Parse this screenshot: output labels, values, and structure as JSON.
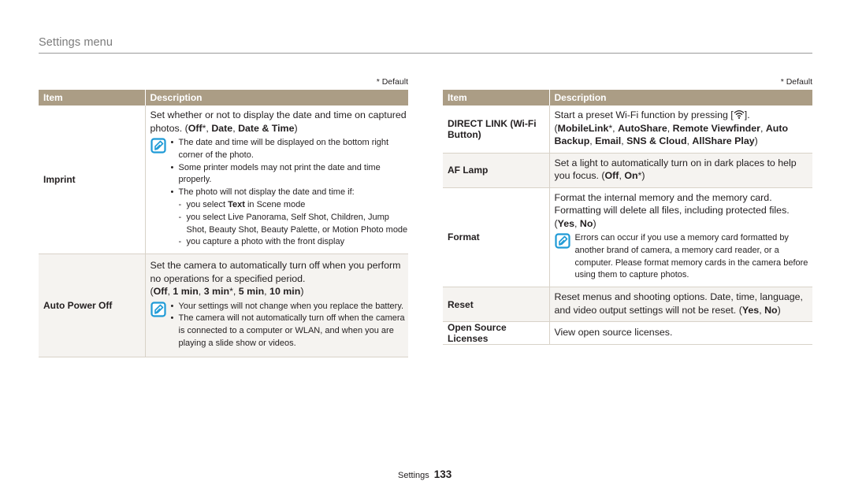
{
  "section_title": "Settings menu",
  "default_note": "* Default",
  "headers": {
    "item": "Item",
    "description": "Description"
  },
  "colors": {
    "header_bg": "#ab9d85",
    "shade_bg": "#f5f3f0",
    "note_icon": "#1e9ad6"
  },
  "left_table": {
    "imprint": {
      "item": "Imprint",
      "lead_1": "Set whether or not to display the date and time on captured photos. (",
      "opt_off": "Off",
      "star_1": "*, ",
      "opt_date": "Date",
      "sep_1": ", ",
      "opt_datetime": "Date & Time",
      "close": ")",
      "note_icon": "note-pencil-icon",
      "bullets": [
        "The date and time will be displayed on the bottom right corner of the photo.",
        "Some printer models may not print the date and time properly.",
        "The photo will not display the date and time if:"
      ],
      "dash_1_pre": "you select ",
      "dash_1_bold": "Text",
      "dash_1_post": " in Scene mode",
      "dash_2": "you select Live Panorama, Self Shot, Children, Jump Shot, Beauty Shot, Beauty Palette, or Motion Photo mode",
      "dash_3": "you capture a photo with the front display"
    },
    "auto_power_off": {
      "item": "Auto Power Off",
      "lead": "Set the camera to automatically turn off when you perform no operations for a specified period.",
      "open": "(",
      "opt_off": "Off",
      "sep_1": ", ",
      "opt_1min": "1 min",
      "sep_2": ", ",
      "opt_3min": "3 min",
      "star": "*, ",
      "opt_5min": "5 min",
      "sep_3": ", ",
      "opt_10min": "10 min",
      "close": ")",
      "note_icon": "note-pencil-icon",
      "bullets": [
        "Your settings will not change when you replace the battery.",
        "The camera will not automatically turn off when the camera is connected to a computer or WLAN, and when you are playing a slide show or videos."
      ]
    }
  },
  "right_table": {
    "direct_link": {
      "item": "DIRECT LINK (Wi-Fi Button)",
      "lead_pre": "Start a preset Wi-Fi function by pressing [",
      "lead_icon": "wifi-icon",
      "lead_post": "].",
      "open": "(",
      "opt_mobilelink": "MobileLink",
      "star": "*, ",
      "opt_autoshare": "AutoShare",
      "sep_1": ", ",
      "opt_remote": "Remote Viewfinder",
      "sep_2": ", ",
      "opt_backup": "Auto Backup",
      "sep_3": ", ",
      "opt_email": "Email",
      "sep_4": ", ",
      "opt_sns": "SNS & Cloud",
      "sep_5": ", ",
      "opt_allshare": "AllShare Play",
      "close": ")"
    },
    "af_lamp": {
      "item": "AF Lamp",
      "lead": "Set a light to automatically turn on in dark places to help you focus. (",
      "opt_off": "Off",
      "sep": ", ",
      "opt_on": "On",
      "close": "*)"
    },
    "format": {
      "item": "Format",
      "lead": "Format the internal memory and the memory card. Formatting will delete all files, including protected files.",
      "open": "(",
      "opt_yes": "Yes",
      "sep": ", ",
      "opt_no": "No",
      "close": ")",
      "note_icon": "note-pencil-icon",
      "note": "Errors can occur if you use a memory card formatted by another brand of camera, a memory card reader, or a computer. Please format memory cards in the camera before using them to capture photos."
    },
    "reset": {
      "item": "Reset",
      "lead": "Reset menus and shooting options. Date, time, language, and video output settings will not be reset. (",
      "opt_yes": "Yes",
      "sep": ", ",
      "opt_no": "No",
      "close": ")"
    },
    "open_source": {
      "item": "Open Source Licenses",
      "lead": "View open source licenses."
    }
  },
  "footer": {
    "section": "Settings",
    "page": "133"
  }
}
